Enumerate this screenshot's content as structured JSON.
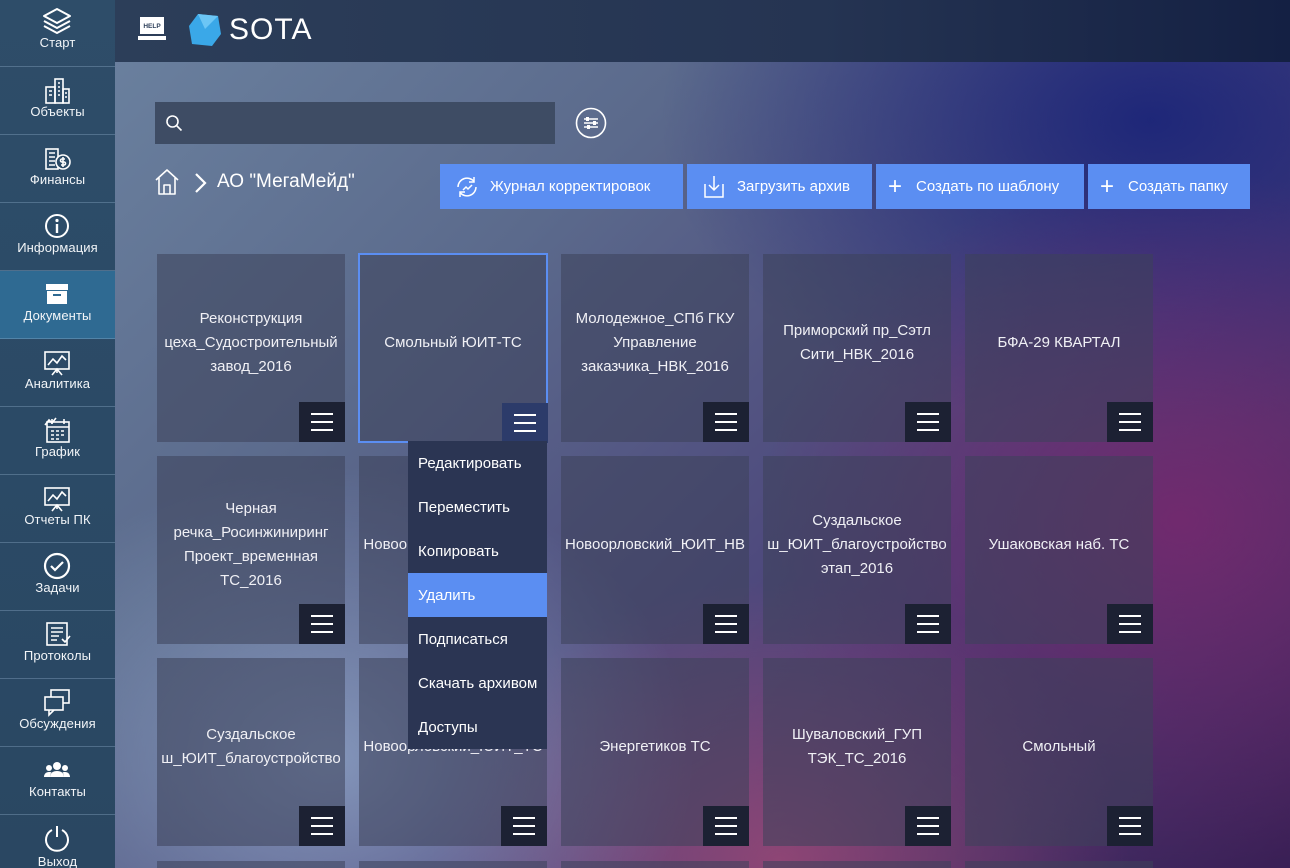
{
  "app": {
    "logo_text": "SOTA",
    "help_label": "HELP"
  },
  "sidebar": {
    "items": [
      {
        "label": "Старт",
        "icon": "layers-icon"
      },
      {
        "label": "Объекты",
        "icon": "buildings-icon"
      },
      {
        "label": "Финансы",
        "icon": "finance-icon"
      },
      {
        "label": "Информация",
        "icon": "info-icon"
      },
      {
        "label": "Документы",
        "icon": "archive-box-icon",
        "active": true
      },
      {
        "label": "Аналитика",
        "icon": "analytics-board-icon"
      },
      {
        "label": "График",
        "icon": "calendar-chart-icon"
      },
      {
        "label": "Отчеты ПК",
        "icon": "report-board-icon"
      },
      {
        "label": "Задачи",
        "icon": "check-circle-icon"
      },
      {
        "label": "Протоколы",
        "icon": "protocol-list-icon"
      },
      {
        "label": "Обсуждения",
        "icon": "discussion-icon"
      },
      {
        "label": "Контакты",
        "icon": "contacts-icon"
      },
      {
        "label": "Выход",
        "icon": "power-icon"
      }
    ]
  },
  "search": {
    "value": "",
    "placeholder": ""
  },
  "breadcrumb": {
    "current": "АО \"МегаМейд\""
  },
  "actions": {
    "journal": "Журнал корректировок",
    "upload": "Загрузить архив",
    "create_template": "Создать по шаблону",
    "create_folder": "Создать папку"
  },
  "tiles": [
    {
      "name": "Реконструкция\nцеха_Судостроительный\nзавод_2016"
    },
    {
      "name": "Смольный ЮИТ-ТС"
    },
    {
      "name": "Молодежное_СПб ГКУ\nУправление\nзаказчика_НВК_2016"
    },
    {
      "name": "Приморский пр_Сэтл\nСити_НВК_2016"
    },
    {
      "name": "БФА-29 КВАРТАЛ"
    },
    {
      "name": "Черная\nречка_Росинжиниринг\nПроект_временная\nТС_2016"
    },
    {
      "name": "Новоорловский_ЮИТ_ТС"
    },
    {
      "name": "Новоорловский_ЮИТ_НВ"
    },
    {
      "name": "Суздальское\nш_ЮИТ_благоустройство\nэтап_2016"
    },
    {
      "name": "Ушаковская наб. ТС"
    },
    {
      "name": "Суздальское\nш_ЮИТ_благоустройство"
    },
    {
      "name": "Новоорловский_ЮИТ_ТС"
    },
    {
      "name": "Энергетиков ТС"
    },
    {
      "name": "Шуваловский_ГУП\nТЭК_ТС_2016"
    },
    {
      "name": "Смольный"
    }
  ],
  "context_menu": {
    "items": [
      "Редактировать",
      "Переместить",
      "Копировать",
      "Удалить",
      "Подписаться",
      "Скачать архивом",
      "Доступы"
    ],
    "highlighted": "Удалить"
  },
  "colors": {
    "accent": "#5b8ef2",
    "sidebar": "#2b4a66",
    "sidebar_active": "#2f6a92",
    "logo": "#3aa8e8"
  }
}
